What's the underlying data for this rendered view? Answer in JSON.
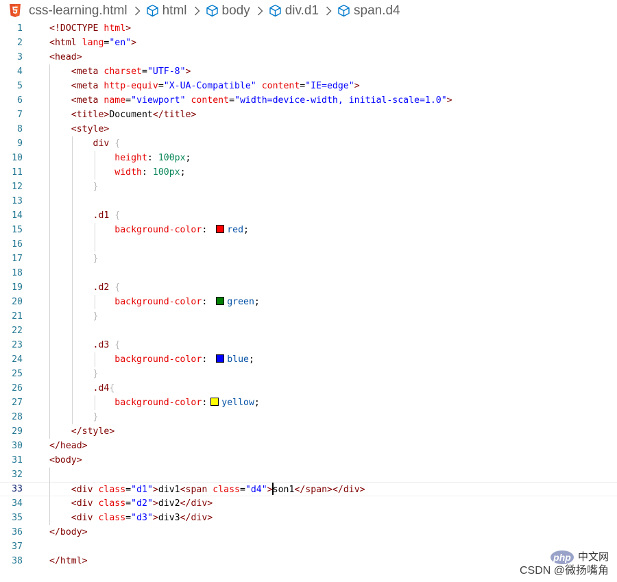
{
  "breadcrumb": {
    "file": "css-learning.html",
    "items": [
      "html",
      "body",
      "div.d1",
      "span.d4"
    ]
  },
  "lines": [
    {
      "n": "1",
      "t": [
        [
          "tag",
          "<!DOCTYPE "
        ],
        [
          "attr",
          "html"
        ],
        [
          "tag",
          ">"
        ]
      ]
    },
    {
      "n": "2",
      "t": [
        [
          "tag",
          "<html "
        ],
        [
          "attr",
          "lang"
        ],
        [
          "txt",
          "="
        ],
        [
          "str",
          "\"en\""
        ],
        [
          "tag",
          ">"
        ]
      ]
    },
    {
      "n": "3",
      "t": [
        [
          "tag",
          "<head>"
        ]
      ]
    },
    {
      "n": "4",
      "t": [
        [
          "txt",
          "    "
        ],
        [
          "tag",
          "<meta "
        ],
        [
          "attr",
          "charset"
        ],
        [
          "txt",
          "="
        ],
        [
          "str",
          "\"UTF-8\""
        ],
        [
          "tag",
          ">"
        ]
      ]
    },
    {
      "n": "5",
      "t": [
        [
          "txt",
          "    "
        ],
        [
          "tag",
          "<meta "
        ],
        [
          "attr",
          "http-equiv"
        ],
        [
          "txt",
          "="
        ],
        [
          "str",
          "\"X-UA-Compatible\""
        ],
        [
          "txt",
          " "
        ],
        [
          "attr",
          "content"
        ],
        [
          "txt",
          "="
        ],
        [
          "str",
          "\"IE=edge\""
        ],
        [
          "tag",
          ">"
        ]
      ]
    },
    {
      "n": "6",
      "t": [
        [
          "txt",
          "    "
        ],
        [
          "tag",
          "<meta "
        ],
        [
          "attr",
          "name"
        ],
        [
          "txt",
          "="
        ],
        [
          "str",
          "\"viewport\""
        ],
        [
          "txt",
          " "
        ],
        [
          "attr",
          "content"
        ],
        [
          "txt",
          "="
        ],
        [
          "str",
          "\"width=device-width, initial-scale=1.0\""
        ],
        [
          "tag",
          ">"
        ]
      ]
    },
    {
      "n": "7",
      "t": [
        [
          "txt",
          "    "
        ],
        [
          "tag",
          "<title>"
        ],
        [
          "txt",
          "Document"
        ],
        [
          "tag",
          "</title>"
        ]
      ]
    },
    {
      "n": "8",
      "t": [
        [
          "txt",
          "    "
        ],
        [
          "tag",
          "<style>"
        ]
      ]
    },
    {
      "n": "9",
      "t": [
        [
          "txt",
          "        "
        ],
        [
          "sel",
          "div"
        ],
        [
          "txt",
          " "
        ],
        [
          "brace",
          "{"
        ]
      ]
    },
    {
      "n": "10",
      "t": [
        [
          "txt",
          "            "
        ],
        [
          "prop",
          "height"
        ],
        [
          "txt",
          ": "
        ],
        [
          "num",
          "100px"
        ],
        [
          "txt",
          ";"
        ]
      ]
    },
    {
      "n": "11",
      "t": [
        [
          "txt",
          "            "
        ],
        [
          "prop",
          "width"
        ],
        [
          "txt",
          ": "
        ],
        [
          "num",
          "100px"
        ],
        [
          "txt",
          ";"
        ]
      ]
    },
    {
      "n": "12",
      "t": [
        [
          "txt",
          "        "
        ],
        [
          "brace",
          "}"
        ]
      ]
    },
    {
      "n": "13",
      "t": []
    },
    {
      "n": "14",
      "t": [
        [
          "txt",
          "        "
        ],
        [
          "sel",
          ".d1"
        ],
        [
          "txt",
          " "
        ],
        [
          "brace",
          "{"
        ]
      ]
    },
    {
      "n": "15",
      "t": [
        [
          "txt",
          "            "
        ],
        [
          "prop",
          "background-color"
        ],
        [
          "txt",
          ": "
        ],
        [
          "swatch",
          "red"
        ],
        [
          "val",
          "red"
        ],
        [
          "txt",
          ";"
        ]
      ]
    },
    {
      "n": "16",
      "t": []
    },
    {
      "n": "17",
      "t": [
        [
          "txt",
          "        "
        ],
        [
          "brace",
          "}"
        ]
      ]
    },
    {
      "n": "18",
      "t": []
    },
    {
      "n": "19",
      "t": [
        [
          "txt",
          "        "
        ],
        [
          "sel",
          ".d2"
        ],
        [
          "txt",
          " "
        ],
        [
          "brace",
          "{"
        ]
      ]
    },
    {
      "n": "20",
      "t": [
        [
          "txt",
          "            "
        ],
        [
          "prop",
          "background-color"
        ],
        [
          "txt",
          ": "
        ],
        [
          "swatch",
          "green"
        ],
        [
          "val",
          "green"
        ],
        [
          "txt",
          ";"
        ]
      ]
    },
    {
      "n": "21",
      "t": [
        [
          "txt",
          "        "
        ],
        [
          "brace",
          "}"
        ]
      ]
    },
    {
      "n": "22",
      "t": []
    },
    {
      "n": "23",
      "t": [
        [
          "txt",
          "        "
        ],
        [
          "sel",
          ".d3"
        ],
        [
          "txt",
          " "
        ],
        [
          "brace",
          "{"
        ]
      ]
    },
    {
      "n": "24",
      "t": [
        [
          "txt",
          "            "
        ],
        [
          "prop",
          "background-color"
        ],
        [
          "txt",
          ": "
        ],
        [
          "swatch",
          "blue"
        ],
        [
          "val",
          "blue"
        ],
        [
          "txt",
          ";"
        ]
      ]
    },
    {
      "n": "25",
      "t": [
        [
          "txt",
          "        "
        ],
        [
          "brace",
          "}"
        ]
      ]
    },
    {
      "n": "26",
      "t": [
        [
          "txt",
          "        "
        ],
        [
          "sel",
          ".d4"
        ],
        [
          "brace",
          "{"
        ]
      ]
    },
    {
      "n": "27",
      "t": [
        [
          "txt",
          "            "
        ],
        [
          "prop",
          "background-color"
        ],
        [
          "txt",
          ":"
        ],
        [
          "swatch",
          "yellow"
        ],
        [
          "val",
          "yellow"
        ],
        [
          "txt",
          ";"
        ]
      ]
    },
    {
      "n": "28",
      "t": [
        [
          "txt",
          "        "
        ],
        [
          "brace",
          "}"
        ]
      ]
    },
    {
      "n": "29",
      "t": [
        [
          "txt",
          "    "
        ],
        [
          "tag",
          "</style>"
        ]
      ]
    },
    {
      "n": "30",
      "t": [
        [
          "tag",
          "</head>"
        ]
      ]
    },
    {
      "n": "31",
      "t": [
        [
          "tag",
          "<body>"
        ]
      ]
    },
    {
      "n": "32",
      "t": []
    },
    {
      "n": "33",
      "current": true,
      "t": [
        [
          "txt",
          "    "
        ],
        [
          "tag",
          "<div "
        ],
        [
          "attr",
          "class"
        ],
        [
          "txt",
          "="
        ],
        [
          "str",
          "\"d1\""
        ],
        [
          "tag",
          ">"
        ],
        [
          "txt",
          "div1"
        ],
        [
          "tag",
          "<span "
        ],
        [
          "attr",
          "class"
        ],
        [
          "txt",
          "="
        ],
        [
          "str",
          "\"d4\""
        ],
        [
          "tag",
          ">"
        ],
        [
          "cursor",
          ""
        ],
        [
          "txt",
          "son1"
        ],
        [
          "tag",
          "</span></div>"
        ]
      ]
    },
    {
      "n": "34",
      "t": [
        [
          "txt",
          "    "
        ],
        [
          "tag",
          "<div "
        ],
        [
          "attr",
          "class"
        ],
        [
          "txt",
          "="
        ],
        [
          "str",
          "\"d2\""
        ],
        [
          "tag",
          ">"
        ],
        [
          "txt",
          "div2"
        ],
        [
          "tag",
          "</div>"
        ]
      ]
    },
    {
      "n": "35",
      "t": [
        [
          "txt",
          "    "
        ],
        [
          "tag",
          "<div "
        ],
        [
          "attr",
          "class"
        ],
        [
          "txt",
          "="
        ],
        [
          "str",
          "\"d3\""
        ],
        [
          "tag",
          ">"
        ],
        [
          "txt",
          "div3"
        ],
        [
          "tag",
          "</div>"
        ]
      ]
    },
    {
      "n": "36",
      "t": [
        [
          "tag",
          "</body>"
        ]
      ]
    },
    {
      "n": "37",
      "t": []
    },
    {
      "n": "38",
      "t": [
        [
          "tag",
          "</html>"
        ]
      ]
    }
  ],
  "colors": {
    "swatch_red": "#ff0000",
    "swatch_green": "#008000",
    "swatch_blue": "#0000ff",
    "swatch_yellow": "#ffff00",
    "html5_brand": "#e44d26",
    "cube_icon": "#007acc"
  },
  "icons": {
    "file": "html5-icon",
    "breadcrumb_item": "cube-icon",
    "separator": "chevron-right-icon"
  },
  "watermark": {
    "php_logo": "php",
    "site": "中文网",
    "csdn": "CSDN @微扬嘴角"
  }
}
